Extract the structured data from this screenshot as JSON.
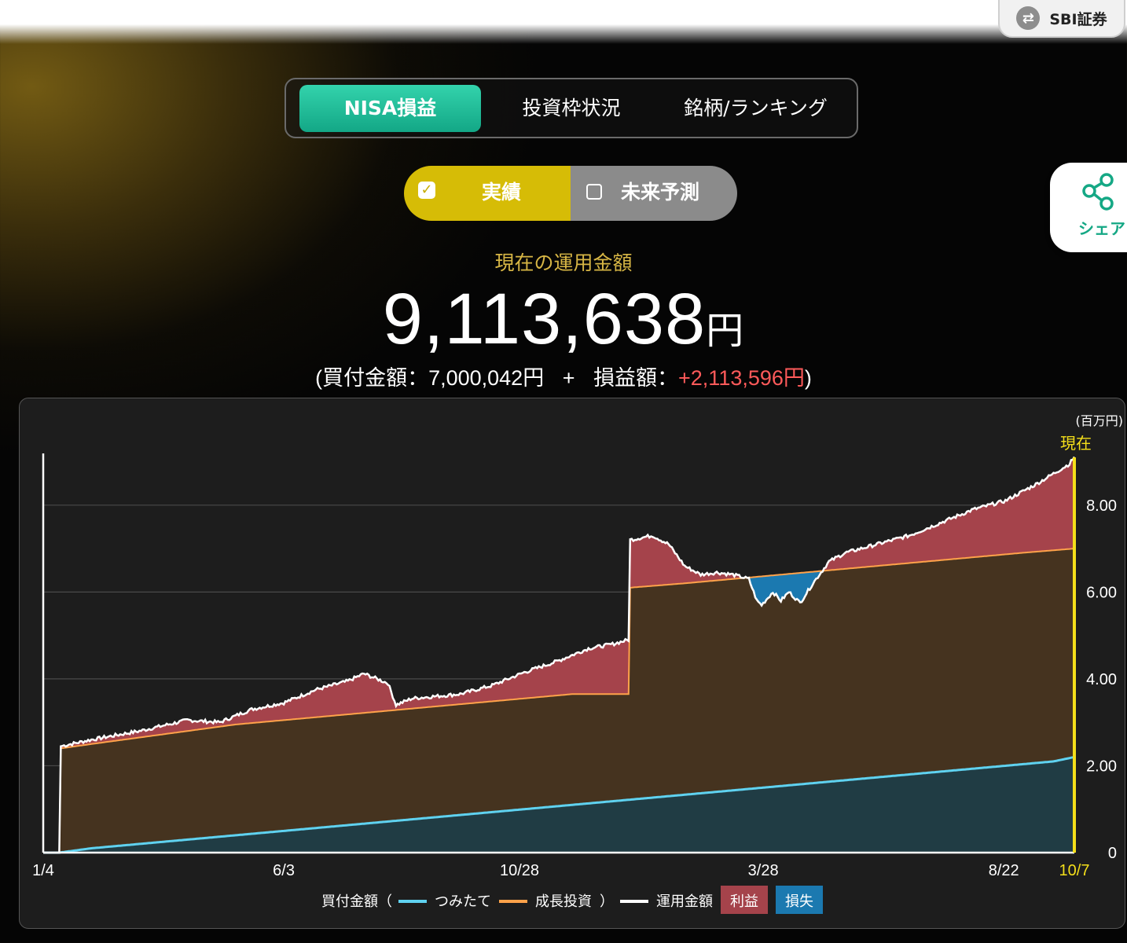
{
  "header": {
    "broker_button": {
      "label": "SBI証券",
      "icon": "swap-icon"
    }
  },
  "tabs": [
    {
      "label": "NISA損益",
      "active": true
    },
    {
      "label": "投資枠状況",
      "active": false
    },
    {
      "label": "銘柄/ランキング",
      "active": false
    }
  ],
  "toggle": {
    "actual": {
      "label": "実績",
      "checked": true
    },
    "forecast": {
      "label": "未来予測",
      "checked": false
    }
  },
  "share": {
    "label": "シェア",
    "icon": "share-icon"
  },
  "summary": {
    "title": "現在の運用金額",
    "amount": "9,113,638",
    "unit": "円",
    "detail_open": "(",
    "purchase_label": "買付金額：",
    "purchase_value": "7,000,042円",
    "plus": "+",
    "pl_label": "損益額：",
    "pl_value": "+2,113,596円",
    "detail_close": ")"
  },
  "colors": {
    "accent_green": "#1fbf98",
    "accent_yellow": "#d6bc06",
    "profit": "#a5434b",
    "loss": "#1b79b0",
    "tsumitate": "#5fd2f0",
    "growth": "#ffa24a",
    "market": "#ffffff"
  },
  "chart_data": {
    "type": "area",
    "unit_label": "(百万円)",
    "current_label": "現在",
    "y_ticks": [
      "0",
      "2.00",
      "4.00",
      "6.00",
      "8.00"
    ],
    "ylim": [
      0,
      9.1
    ],
    "x_ticks": [
      "1/4",
      "6/3",
      "10/28",
      "3/28",
      "8/22",
      "10/7"
    ],
    "x_tick_index": [
      0,
      150,
      297,
      449,
      599,
      643
    ],
    "n_points": 644,
    "series": [
      {
        "name": "つみたて",
        "key": "tsumitate",
        "points": [
          [
            0,
            0
          ],
          [
            10,
            0
          ],
          [
            30,
            0.1
          ],
          [
            60,
            0.2
          ],
          [
            90,
            0.3
          ],
          [
            120,
            0.4
          ],
          [
            150,
            0.5
          ],
          [
            180,
            0.6
          ],
          [
            210,
            0.7
          ],
          [
            240,
            0.8
          ],
          [
            270,
            0.9
          ],
          [
            300,
            1.0
          ],
          [
            330,
            1.1
          ],
          [
            360,
            1.2
          ],
          [
            390,
            1.3
          ],
          [
            420,
            1.4
          ],
          [
            450,
            1.5
          ],
          [
            480,
            1.6
          ],
          [
            510,
            1.7
          ],
          [
            540,
            1.8
          ],
          [
            570,
            1.9
          ],
          [
            600,
            2.0
          ],
          [
            630,
            2.1
          ],
          [
            643,
            2.2
          ]
        ]
      },
      {
        "name": "成長投資",
        "key": "growth",
        "points": [
          [
            0,
            0
          ],
          [
            10,
            0
          ],
          [
            11,
            2.4
          ],
          [
            30,
            2.5
          ],
          [
            60,
            2.65
          ],
          [
            90,
            2.8
          ],
          [
            120,
            2.95
          ],
          [
            150,
            3.05
          ],
          [
            180,
            3.15
          ],
          [
            210,
            3.25
          ],
          [
            240,
            3.35
          ],
          [
            270,
            3.45
          ],
          [
            300,
            3.55
          ],
          [
            330,
            3.65
          ],
          [
            365,
            3.65
          ],
          [
            366,
            6.1
          ],
          [
            400,
            6.2
          ],
          [
            430,
            6.3
          ],
          [
            460,
            6.4
          ],
          [
            490,
            6.5
          ],
          [
            520,
            6.6
          ],
          [
            550,
            6.7
          ],
          [
            580,
            6.8
          ],
          [
            610,
            6.9
          ],
          [
            643,
            7.0
          ]
        ]
      },
      {
        "name": "運用金額",
        "key": "market",
        "points": [
          [
            0,
            0
          ],
          [
            10,
            0
          ],
          [
            11,
            2.45
          ],
          [
            30,
            2.6
          ],
          [
            60,
            2.8
          ],
          [
            90,
            3.05
          ],
          [
            110,
            3.0
          ],
          [
            130,
            3.3
          ],
          [
            150,
            3.45
          ],
          [
            170,
            3.75
          ],
          [
            190,
            3.95
          ],
          [
            200,
            4.12
          ],
          [
            215,
            3.9
          ],
          [
            220,
            3.4
          ],
          [
            230,
            3.55
          ],
          [
            260,
            3.65
          ],
          [
            280,
            3.85
          ],
          [
            300,
            4.15
          ],
          [
            320,
            4.4
          ],
          [
            340,
            4.7
          ],
          [
            355,
            4.8
          ],
          [
            365,
            4.9
          ],
          [
            366,
            7.2
          ],
          [
            380,
            7.3
          ],
          [
            390,
            7.1
          ],
          [
            400,
            6.6
          ],
          [
            410,
            6.4
          ],
          [
            420,
            6.45
          ],
          [
            430,
            6.4
          ],
          [
            440,
            6.3
          ],
          [
            445,
            5.8
          ],
          [
            448,
            5.7
          ],
          [
            455,
            6.0
          ],
          [
            460,
            5.8
          ],
          [
            465,
            6.0
          ],
          [
            472,
            5.75
          ],
          [
            480,
            6.2
          ],
          [
            490,
            6.7
          ],
          [
            500,
            6.9
          ],
          [
            520,
            7.1
          ],
          [
            540,
            7.3
          ],
          [
            560,
            7.6
          ],
          [
            580,
            7.9
          ],
          [
            600,
            8.1
          ],
          [
            620,
            8.5
          ],
          [
            640,
            8.95
          ],
          [
            643,
            9.11
          ]
        ]
      }
    ],
    "legend": {
      "prefix": "買付金額（",
      "tsumitate": "つみたて",
      "growth": "成長投資",
      "suffix": "）",
      "market": "運用金額",
      "profit": "利益",
      "loss": "損失"
    },
    "grid": true
  }
}
